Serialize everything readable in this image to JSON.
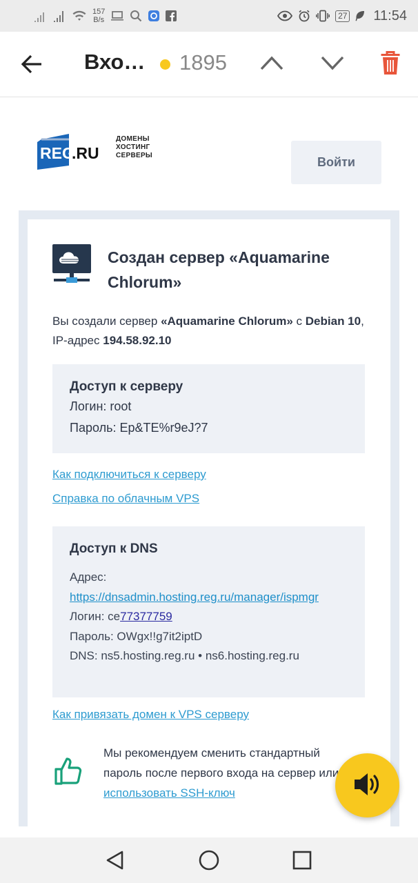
{
  "status_bar": {
    "speed_value": "157",
    "speed_unit": "B/s",
    "battery": "27",
    "time": "11:54"
  },
  "app_bar": {
    "title": "Вхо…",
    "count": "1895"
  },
  "header": {
    "logo_main": "REG",
    "logo_suffix": ".RU",
    "logo_tag_1": "ДОМЕНЫ",
    "logo_tag_2": "ХОСТИНГ",
    "logo_tag_3": "СЕРВЕРЫ",
    "login_button": "Войти"
  },
  "email": {
    "title": "Создан сервер «Aquamarine Chlorum»",
    "intro": {
      "p1": "Вы создали сервер ",
      "server_name": "«Aquamarine Chlorum»",
      "p2": " с ",
      "os": "Debian 10",
      "p3": ", IP-адрес ",
      "ip": "194.58.92.10"
    },
    "server_access": {
      "heading": "Доступ к серверу",
      "login": "Логин: root",
      "password": "Пароль: Ep&TE%r9eJ?7"
    },
    "link_connect": "Как подключиться к серверу",
    "link_help": "Справка по облачным VPS",
    "dns_access": {
      "heading": "Доступ к DNS",
      "address_label": "Адрес:",
      "address_url": "https://dnsadmin.hosting.reg.ru/manager/ispmgr",
      "login_prefix": "Логин: ce",
      "login_number": "77377759",
      "password": "Пароль: OWgx!!g7it2iptD",
      "dns": "DNS: ns5.hosting.reg.ru • ns6.hosting.reg.ru"
    },
    "link_bind_domain": "Как привязать домен к VPS серверу",
    "recommend": {
      "text": "Мы рекомендуем сменить стандартный пароль после первого входа на сервер или ",
      "link": "использовать SSH-ключ"
    }
  },
  "colors": {
    "accent_yellow": "#f8c81e",
    "link_blue": "#2d9bd0",
    "trash_red": "#e8553a",
    "logo_blue": "#1a66b8",
    "thumb_green": "#19a17a"
  }
}
